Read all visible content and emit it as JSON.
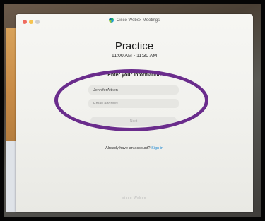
{
  "app": {
    "window_title": "Cisco Webex Meetings",
    "logo_icon": "webex-logo-icon"
  },
  "meeting": {
    "title": "Practice",
    "time": "11:00 AM - 11:30 AM"
  },
  "form": {
    "heading": "Enter your information",
    "name_value": "JenniferAitken",
    "email_placeholder": "Email address",
    "next_label": "Next"
  },
  "account": {
    "prompt": "Already have an account?",
    "signin_label": "Sign in"
  },
  "footer": {
    "brand": "cisco Webex"
  },
  "colors": {
    "annotation": "#6a2c8c",
    "link": "#2a8fd4",
    "close": "#ef6b5e",
    "minimize": "#f6c44f"
  }
}
